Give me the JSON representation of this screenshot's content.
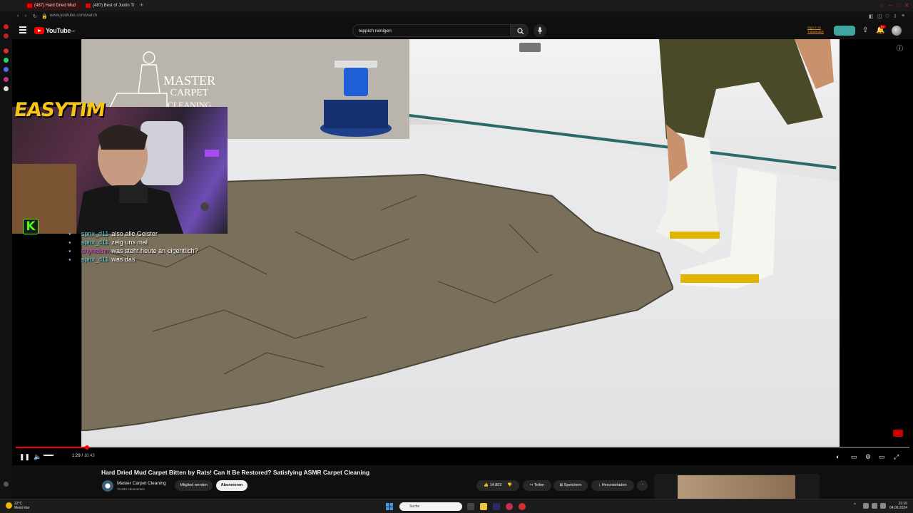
{
  "browser": {
    "tabs": [
      {
        "label": "(487) Hard Dried Mud"
      },
      {
        "label": "(487) Best of Justin Ti"
      }
    ],
    "url": "www.youtube.com/watch"
  },
  "youtube": {
    "logo_text": "YouTube",
    "logo_country": "DE",
    "search_value": "teppich reinigen",
    "signin_text_1": "Sign in to",
    "signin_text_2": "TubeBuddy",
    "notification_count": "9+"
  },
  "video_overlay": {
    "watermark_line1": "MASTER",
    "watermark_line2": "CARPET",
    "watermark_line3": "CLEANING",
    "streamer_name": "EASYTIM",
    "kick_badge": "K"
  },
  "chat": [
    {
      "user": "spnx_d11",
      "message": "also alle Geister",
      "color": "#5ad1e0",
      "badge": "·★"
    },
    {
      "user": "spnx_d11",
      "message": "zeig uns mal",
      "color": "#5ad1e0",
      "badge": "·★"
    },
    {
      "user": "chyneknn",
      "message": "was steht heute an eigentlich?",
      "color": "#e04ad6",
      "badge": "·★"
    },
    {
      "user": "spnx_d11",
      "message": "was das",
      "color": "#5ad1e0",
      "badge": "·★"
    }
  ],
  "player": {
    "time_current": "1:29",
    "time_total": "18:43",
    "progress_fraction": 0.08
  },
  "video": {
    "title": "Hard Dried Mud Carpet Bitten by Rats! Can It Be Restored? Satisfying ASMR Carpet Cleaning",
    "channel_name": "Master Carpet Cleaning",
    "subscriber_count": "76.500 Abonnenten",
    "join_label": "Mitglied werden",
    "subscribe_label": "Abonnieren",
    "like_count": "14.802",
    "share_label": "Teilen",
    "save_label": "Speichern",
    "download_label": "Herunterladen"
  },
  "taskbar": {
    "weather_temp": "22°C",
    "weather_desc": "Meist klar",
    "search_placeholder": "Suche",
    "clock_time": "23:10",
    "clock_date": "04.06.2024"
  }
}
